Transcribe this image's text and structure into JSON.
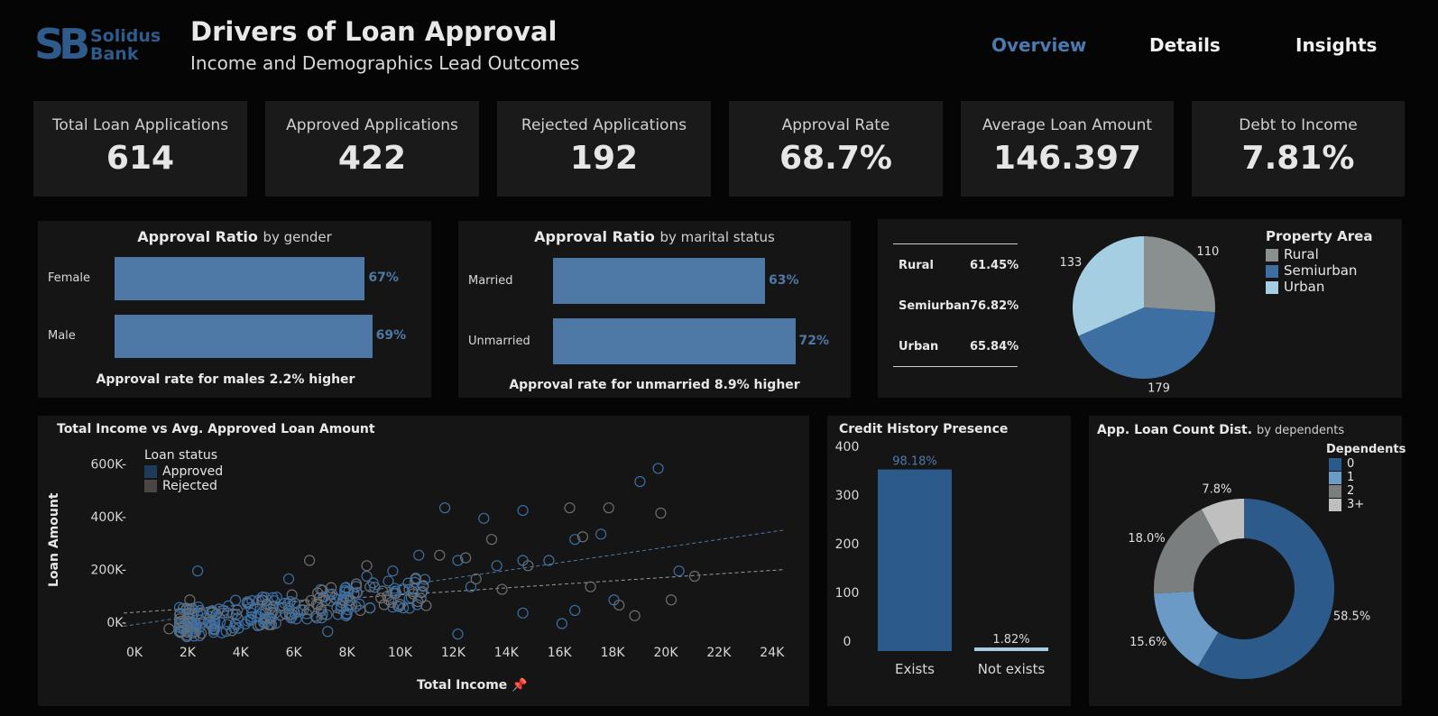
{
  "header": {
    "logo_mark": "SB",
    "logo_line1": "Solidus",
    "logo_line2": "Bank",
    "title": "Drivers of Loan Approval",
    "subtitle": "Income and Demographics Lead Outcomes"
  },
  "nav": {
    "overview": "Overview",
    "details": "Details",
    "insights": "Insights"
  },
  "colors": {
    "accent": "#4e79a7",
    "dark_blue": "#2c5a8a",
    "light_blue": "#a6cee3",
    "grey": "#8a8f8f",
    "rejected": "#6e6e6e"
  },
  "kpis": [
    {
      "label": "Total Loan Applications",
      "value": "614"
    },
    {
      "label": "Approved Applications",
      "value": "422"
    },
    {
      "label": "Rejected Applications",
      "value": "192"
    },
    {
      "label": "Approval Rate",
      "value": "68.7%"
    },
    {
      "label": "Average Loan Amount",
      "value": "146.397"
    },
    {
      "label": "Debt to Income",
      "value": "7.81%"
    }
  ],
  "chart_data": [
    {
      "type": "bar",
      "title": "Approval Ratio",
      "subtitle": "by gender",
      "categories": [
        "Female",
        "Male"
      ],
      "values": [
        67,
        69
      ],
      "value_labels": [
        "67%",
        "69%"
      ],
      "note": "Approval rate for males 2.2% higher"
    },
    {
      "type": "bar",
      "title": "Approval Ratio",
      "subtitle": "by marital status",
      "categories": [
        "Married",
        "Unmarried"
      ],
      "values": [
        63,
        72
      ],
      "value_labels": [
        "63%",
        "72%"
      ],
      "note": "Approval rate for unmarried 8.9% higher"
    },
    {
      "type": "table",
      "rows": [
        {
          "area": "Rural",
          "rate": "61.45%"
        },
        {
          "area": "Semiurban",
          "rate": "76.82%"
        },
        {
          "area": "Urban",
          "rate": "65.84%"
        }
      ]
    },
    {
      "type": "pie",
      "legend_title": "Property Area",
      "categories": [
        "Rural",
        "Semiurban",
        "Urban"
      ],
      "values": [
        110,
        179,
        133
      ],
      "labels": [
        "110",
        "179",
        "133"
      ],
      "colors": [
        "#8a8f8f",
        "#3d6fa3",
        "#a6cee3"
      ]
    },
    {
      "type": "scatter",
      "title": "Total Income vs Avg. Approved Loan Amount",
      "xlabel": "Total Income",
      "ylabel": "Loan Amount",
      "legend_title": "Loan status",
      "series_names": [
        "Approved",
        "Rejected"
      ],
      "xlim": [
        0,
        25000
      ],
      "ylim": [
        -30000,
        680000
      ],
      "xticks": [
        "0K",
        "2K",
        "4K",
        "6K",
        "8K",
        "10K",
        "12K",
        "14K",
        "16K",
        "18K",
        "20K",
        "22K",
        "24K"
      ],
      "yticks": [
        "0K-",
        "200K-",
        "400K-",
        "600K-"
      ],
      "trend_approved": [
        [
          0,
          50000
        ],
        [
          25000,
          415000
        ]
      ],
      "trend_rejected": [
        [
          0,
          100000
        ],
        [
          25000,
          265000
        ]
      ],
      "approved_highlights": [
        [
          12000,
          500000
        ],
        [
          13500,
          460000
        ],
        [
          15000,
          490000
        ],
        [
          19500,
          600000
        ],
        [
          20200,
          650000
        ],
        [
          18000,
          400000
        ],
        [
          17000,
          380000
        ],
        [
          16000,
          300000
        ],
        [
          14000,
          280000
        ],
        [
          12500,
          300000
        ],
        [
          10000,
          260000
        ],
        [
          11000,
          320000
        ],
        [
          9000,
          240000
        ],
        [
          15000,
          300000
        ],
        [
          13000,
          200000
        ],
        [
          16500,
          60000
        ],
        [
          12500,
          20000
        ],
        [
          15000,
          100000
        ],
        [
          17000,
          110000
        ],
        [
          18500,
          150000
        ],
        [
          21000,
          260000
        ],
        [
          2500,
          260000
        ],
        [
          7500,
          30000
        ],
        [
          6000,
          230000
        ]
      ],
      "rejected_highlights": [
        [
          16800,
          500000
        ],
        [
          18300,
          500000
        ],
        [
          20300,
          480000
        ],
        [
          13800,
          380000
        ],
        [
          17300,
          390000
        ],
        [
          15200,
          280000
        ],
        [
          12800,
          310000
        ],
        [
          11800,
          320000
        ],
        [
          21600,
          240000
        ],
        [
          20700,
          150000
        ],
        [
          19300,
          90000
        ],
        [
          17600,
          200000
        ],
        [
          18700,
          130000
        ],
        [
          14200,
          190000
        ],
        [
          13200,
          230000
        ],
        [
          2200,
          150000
        ],
        [
          1400,
          40000
        ],
        [
          6800,
          300000
        ],
        [
          9000,
          280000
        ]
      ]
    },
    {
      "type": "bar",
      "title": "Credit History Presence",
      "categories": [
        "Exists",
        "Not exists"
      ],
      "values": [
        373,
        7
      ],
      "value_labels": [
        "98.18%",
        "1.82%"
      ],
      "yticks": [
        "0",
        "100",
        "200",
        "300",
        "400"
      ],
      "ylim": [
        0,
        400
      ]
    },
    {
      "type": "pie",
      "donut": true,
      "title": "App. Loan Count Dist.",
      "subtitle": "by dependents",
      "legend_title": "Dependents",
      "categories": [
        "0",
        "1",
        "2",
        "3+"
      ],
      "values": [
        58.5,
        15.6,
        18.0,
        7.8
      ],
      "labels": [
        "58.5%",
        "15.6%",
        "18.0%",
        "7.8%"
      ],
      "colors": [
        "#2c5a8a",
        "#6b9ac6",
        "#7a7e7e",
        "#bfbfbf"
      ]
    }
  ]
}
